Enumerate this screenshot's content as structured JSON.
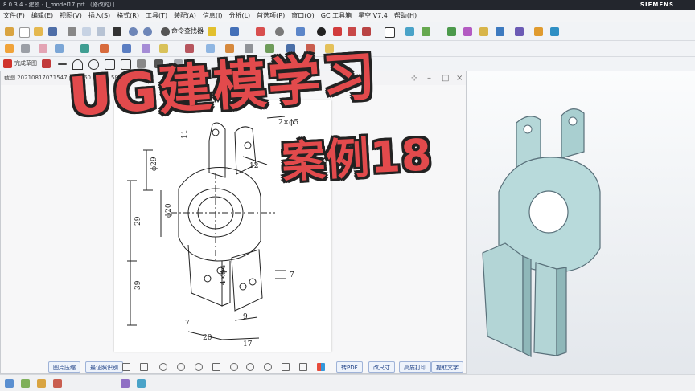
{
  "titlebar": {
    "text": "8.0.3.4 - 建模 - [_model17.prt （修改的）]",
    "brand": "SIEMENS"
  },
  "menu": [
    "文件(F)",
    "编辑(E)",
    "视图(V)",
    "插入(S)",
    "格式(R)",
    "工具(T)",
    "装配(A)",
    "信息(I)",
    "分析(L)",
    "首选项(P)",
    "窗口(O)",
    "GC 工具箱",
    "星空 V7.4",
    "帮助(H)"
  ],
  "toolbar": {
    "cmd_finder": "命令查找器",
    "sketch_label": "完成草图"
  },
  "image_window": {
    "title": "截图 20210817071547.png (60.98KB, 589*700像素)",
    "buttons": {
      "compress": "图片压缩",
      "id_photo": "最证照识别",
      "to_pdf": "转PDF",
      "resize": "改尺寸",
      "print": "高质打印",
      "ocr": "提取文字"
    }
  },
  "overlay": {
    "title": "UG建模学习",
    "subtitle": "案例18"
  },
  "drawing": {
    "dims": {
      "holes_top": "2×ϕ5",
      "d29": "ϕ29",
      "d20": "ϕ20",
      "h29": "29",
      "h39": "39",
      "holes_bottom": "4×ϕ4",
      "v7": "7",
      "v9": "9",
      "v12": "12",
      "v11": "11",
      "w20": "20",
      "w17": "17",
      "b7": "7"
    }
  }
}
